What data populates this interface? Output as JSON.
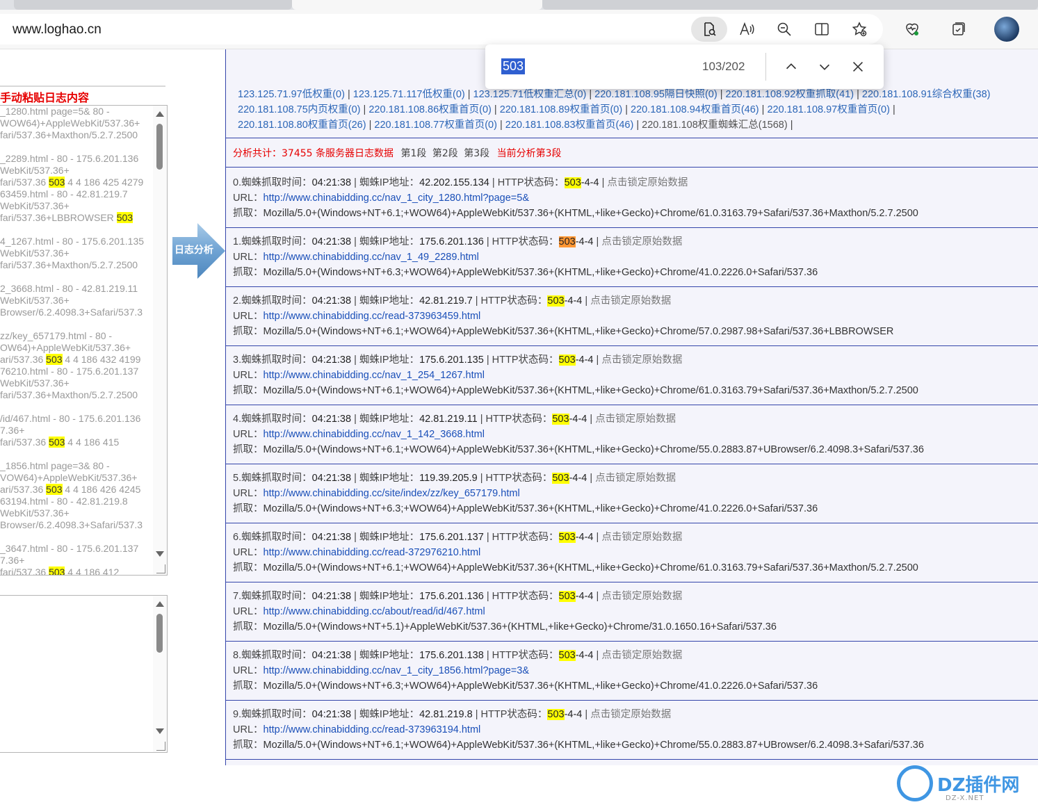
{
  "browser": {
    "address": "www.loghao.cn",
    "find": {
      "query": "503",
      "count": "103/202"
    }
  },
  "left_panel": {
    "title": "手动粘贴日志内容",
    "analyze_button": "日志分析",
    "log_lines": [
      {
        "t": "_1280.html page=5& 80 -"
      },
      {
        "t": "WOW64)+AppleWebKit/537.36+"
      },
      {
        "t": "fari/537.36+Maxthon/5.2.7.2500"
      },
      {
        "t": ""
      },
      {
        "t": "_2289.html - 80 - 175.6.201.136"
      },
      {
        "t": "WebKit/537.36+"
      },
      {
        "t": "fari/537.36 ",
        "hl": "503",
        "after": " 4 4 186 425 4279"
      },
      {
        "t": "63459.html - 80 - 42.81.219.7"
      },
      {
        "t": "WebKit/537.36+"
      },
      {
        "t": "fari/537.36+LBBROWSER ",
        "hl": "503",
        "after": ""
      },
      {
        "t": ""
      },
      {
        "t": "4_1267.html - 80 - 175.6.201.135"
      },
      {
        "t": "WebKit/537.36+"
      },
      {
        "t": "fari/537.36+Maxthon/5.2.7.2500"
      },
      {
        "t": ""
      },
      {
        "t": "2_3668.html - 80 - 42.81.219.11"
      },
      {
        "t": "WebKit/537.36+"
      },
      {
        "t": "Browser/6.2.4098.3+Safari/537.3"
      },
      {
        "t": ""
      },
      {
        "t": "zz/key_657179.html - 80 -"
      },
      {
        "t": "OW64)+AppleWebKit/537.36+"
      },
      {
        "t": "ari/537.36 ",
        "hl": "503",
        "after": " 4 4 186 432 4199"
      },
      {
        "t": "76210.html - 80 - 175.6.201.137"
      },
      {
        "t": "WebKit/537.36+"
      },
      {
        "t": "fari/537.36+Maxthon/5.2.7.2500"
      },
      {
        "t": ""
      },
      {
        "t": "/id/467.html - 80 - 175.6.201.136"
      },
      {
        "t": "7.36+"
      },
      {
        "t": "fari/537.36 ",
        "hl": "503",
        "after": " 4 4 186 415"
      },
      {
        "t": ""
      },
      {
        "t": "_1856.html page=3& 80 -"
      },
      {
        "t": "VOW64)+AppleWebKit/537.36+"
      },
      {
        "t": "ari/537.36 ",
        "hl": "503",
        "after": " 4 4 186 426 4245"
      },
      {
        "t": "63194.html - 80 - 42.81.219.8"
      },
      {
        "t": "WebKit/537.36+"
      },
      {
        "t": "Browser/6.2.4098.3+Safari/537.3"
      },
      {
        "t": ""
      },
      {
        "t": "_3647.html - 80 - 175.6.201.137"
      },
      {
        "t": "7.36+"
      },
      {
        "t": "fari/537.36 ",
        "hl": "503",
        "after": " 4 4 186 412"
      }
    ]
  },
  "ip_summary": {
    "line1": [
      {
        "text": "123.125.71.97低权重(0)"
      },
      {
        "text": "123.125.71.117低权重(0)"
      },
      {
        "text": "123.125.71低权重汇总(0)"
      },
      {
        "text": "220.181.108.95隔日快照(0)"
      },
      {
        "text": "220.181.108.92权重抓取(41)"
      },
      {
        "text": "220.181.108.91综合权重(38)"
      }
    ],
    "line2": [
      {
        "text": "220.181.108.75内页权重(0)"
      },
      {
        "text": "220.181.108.86权重首页(0)"
      },
      {
        "text": "220.181.108.89权重首页(0)"
      },
      {
        "text": "220.181.108.94权重首页(46)"
      },
      {
        "text": "220.181.108.97权重首页(0)"
      }
    ],
    "line3": [
      {
        "text": "220.181.108.80权重首页(26)"
      },
      {
        "text": "220.181.108.77权重首页(0)"
      },
      {
        "text": "220.181.108.83权重首页(46)"
      },
      {
        "text": "220.181.108权重蜘蛛汇总(1568)",
        "plain": true
      }
    ]
  },
  "summary": {
    "text": "分析共计：37455 条服务器日志数据",
    "segments": [
      "第1段",
      "第2段",
      "第3段"
    ],
    "current": "当前分析第3段"
  },
  "labels": {
    "time": "蜘蛛抓取时间：",
    "ip": "蜘蛛IP地址：",
    "status": "HTTP状态码：",
    "lock": "点击锁定原始数据",
    "url": "URL：",
    "ua": "抓取："
  },
  "records": [
    {
      "idx": "0.",
      "time": "04:21:38",
      "ip": "42.202.155.134",
      "code": "503",
      "code_rest": "-4-4",
      "url": "http://www.chinabidding.cc/nav_1_city_1280.html?page=5&",
      "ua": "Mozilla/5.0+(Windows+NT+6.1;+WOW64)+AppleWebKit/537.36+(KHTML,+like+Gecko)+Chrome/61.0.3163.79+Safari/537.36+Maxthon/5.2.7.2500"
    },
    {
      "idx": "1.",
      "time": "04:21:38",
      "ip": "175.6.201.136",
      "code": "503",
      "code_rest": "-4-4",
      "current": true,
      "url": "http://www.chinabidding.cc/nav_1_49_2289.html",
      "ua": "Mozilla/5.0+(Windows+NT+6.3;+WOW64)+AppleWebKit/537.36+(KHTML,+like+Gecko)+Chrome/41.0.2226.0+Safari/537.36"
    },
    {
      "idx": "2.",
      "time": "04:21:38",
      "ip": "42.81.219.7",
      "code": "503",
      "code_rest": "-4-4",
      "url": "http://www.chinabidding.cc/read-373963459.html",
      "ua": "Mozilla/5.0+(Windows+NT+6.1;+WOW64)+AppleWebKit/537.36+(KHTML,+like+Gecko)+Chrome/57.0.2987.98+Safari/537.36+LBBROWSER"
    },
    {
      "idx": "3.",
      "time": "04:21:38",
      "ip": "175.6.201.135",
      "code": "503",
      "code_rest": "-4-4",
      "url": "http://www.chinabidding.cc/nav_1_254_1267.html",
      "ua": "Mozilla/5.0+(Windows+NT+6.1;+WOW64)+AppleWebKit/537.36+(KHTML,+like+Gecko)+Chrome/61.0.3163.79+Safari/537.36+Maxthon/5.2.7.2500"
    },
    {
      "idx": "4.",
      "time": "04:21:38",
      "ip": "42.81.219.11",
      "code": "503",
      "code_rest": "-4-4",
      "url": "http://www.chinabidding.cc/nav_1_142_3668.html",
      "ua": "Mozilla/5.0+(Windows+NT+6.1;+WOW64)+AppleWebKit/537.36+(KHTML,+like+Gecko)+Chrome/55.0.2883.87+UBrowser/6.2.4098.3+Safari/537.36"
    },
    {
      "idx": "5.",
      "time": "04:21:38",
      "ip": "119.39.205.9",
      "code": "503",
      "code_rest": "-4-4",
      "url": "http://www.chinabidding.cc/site/index/zz/key_657179.html",
      "ua": "Mozilla/5.0+(Windows+NT+6.3;+WOW64)+AppleWebKit/537.36+(KHTML,+like+Gecko)+Chrome/41.0.2226.0+Safari/537.36"
    },
    {
      "idx": "6.",
      "time": "04:21:38",
      "ip": "175.6.201.137",
      "code": "503",
      "code_rest": "-4-4",
      "url": "http://www.chinabidding.cc/read-372976210.html",
      "ua": "Mozilla/5.0+(Windows+NT+6.1;+WOW64)+AppleWebKit/537.36+(KHTML,+like+Gecko)+Chrome/61.0.3163.79+Safari/537.36+Maxthon/5.2.7.2500"
    },
    {
      "idx": "7.",
      "time": "04:21:38",
      "ip": "175.6.201.136",
      "code": "503",
      "code_rest": "-4-4",
      "url": "http://www.chinabidding.cc/about/read/id/467.html",
      "ua": "Mozilla/5.0+(Windows+NT+5.1)+AppleWebKit/537.36+(KHTML,+like+Gecko)+Chrome/31.0.1650.16+Safari/537.36"
    },
    {
      "idx": "8.",
      "time": "04:21:38",
      "ip": "175.6.201.138",
      "code": "503",
      "code_rest": "-4-4",
      "url": "http://www.chinabidding.cc/nav_1_city_1856.html?page=3&",
      "ua": "Mozilla/5.0+(Windows+NT+6.3;+WOW64)+AppleWebKit/537.36+(KHTML,+like+Gecko)+Chrome/41.0.2226.0+Safari/537.36"
    },
    {
      "idx": "9.",
      "time": "04:21:38",
      "ip": "42.81.219.8",
      "code": "503",
      "code_rest": "-4-4",
      "url": "http://www.chinabidding.cc/read-373963194.html",
      "ua": "Mozilla/5.0+(Windows+NT+6.1;+WOW64)+AppleWebKit/537.36+(KHTML,+like+Gecko)+Chrome/55.0.2883.87+UBrowser/6.2.4098.3+Safari/537.36"
    }
  ],
  "watermark": {
    "brand": "DZ插件网",
    "site": "DZ-X.NET"
  },
  "colors": {
    "accent_red": "#e60000",
    "link_blue": "#1a4fb8",
    "highlight": "#ffff00",
    "current_match": "#ff9632",
    "border_blue": "#3344aa"
  }
}
